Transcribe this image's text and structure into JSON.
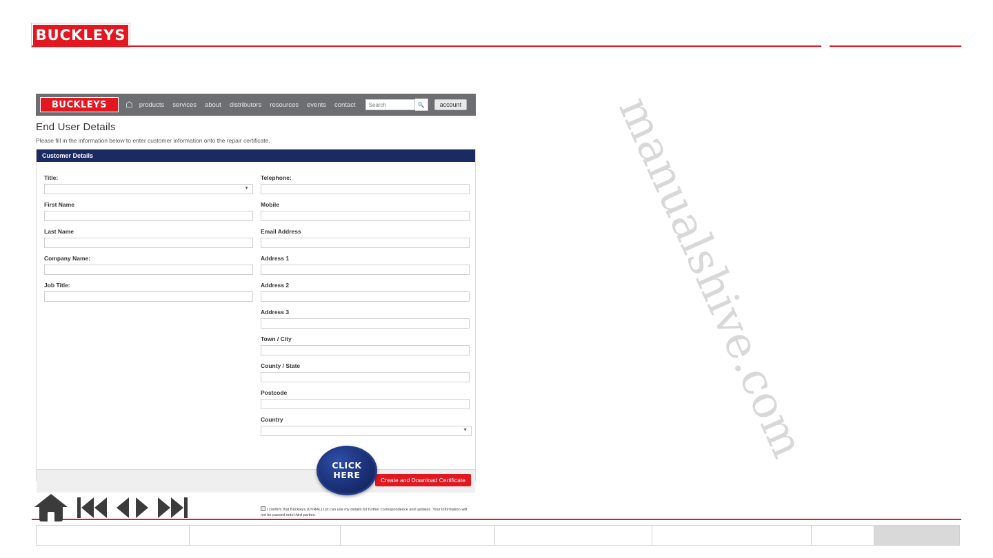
{
  "brand": {
    "logo_text": "BUCKLEYS",
    "accent_color": "#e2171f",
    "panel_header_color": "#1b2a60"
  },
  "watermark": {
    "text": "manualshive.com"
  },
  "nav": {
    "logo_text": "BUCKLEYS",
    "home_icon": "home-icon",
    "links": [
      "products",
      "services",
      "about",
      "distributors",
      "resources",
      "events",
      "contact"
    ],
    "search": {
      "placeholder": "Search",
      "icon": "search-icon"
    },
    "account_label": "account"
  },
  "page": {
    "title": "End User Details",
    "subtitle": "Please fill in the information below to enter customer information onto the repair certificate."
  },
  "panel": {
    "header": "Customer Details",
    "left_fields": [
      {
        "label": "Title:",
        "type": "select",
        "value": ""
      },
      {
        "label": "First Name",
        "type": "text",
        "value": ""
      },
      {
        "label": "Last Name",
        "type": "text",
        "value": ""
      },
      {
        "label": "Company Name:",
        "type": "text",
        "value": ""
      },
      {
        "label": "Job Title:",
        "type": "text",
        "value": ""
      }
    ],
    "right_fields": [
      {
        "label": "Telephone:",
        "type": "text",
        "value": ""
      },
      {
        "label": "Mobile",
        "type": "text",
        "value": ""
      },
      {
        "label": "Email Address",
        "type": "text",
        "value": ""
      },
      {
        "label": "Address 1",
        "type": "text",
        "value": ""
      },
      {
        "label": "Address 2",
        "type": "text",
        "value": ""
      },
      {
        "label": "Address 3",
        "type": "text",
        "value": ""
      },
      {
        "label": "Town / City",
        "type": "text",
        "value": ""
      },
      {
        "label": "County / State",
        "type": "text",
        "value": ""
      },
      {
        "label": "Postcode",
        "type": "text",
        "value": ""
      },
      {
        "label": "Country",
        "type": "select",
        "value": ""
      }
    ],
    "consent_text": "I confirm that Buckleys (UVRAL) Ltd can use my details for further correspondence and updates. Your information will not be passed onto third parties.",
    "consent_checked": true,
    "submit_label": "Create and Download Certificate"
  },
  "callout": {
    "line1": "CLICK",
    "line2": "HERE"
  },
  "player_controls": [
    {
      "name": "home-icon",
      "label": "home"
    },
    {
      "name": "skip-back-icon",
      "label": "first"
    },
    {
      "name": "previous-icon",
      "label": "previous"
    },
    {
      "name": "play-icon",
      "label": "play"
    },
    {
      "name": "skip-forward-icon",
      "label": "last"
    }
  ]
}
